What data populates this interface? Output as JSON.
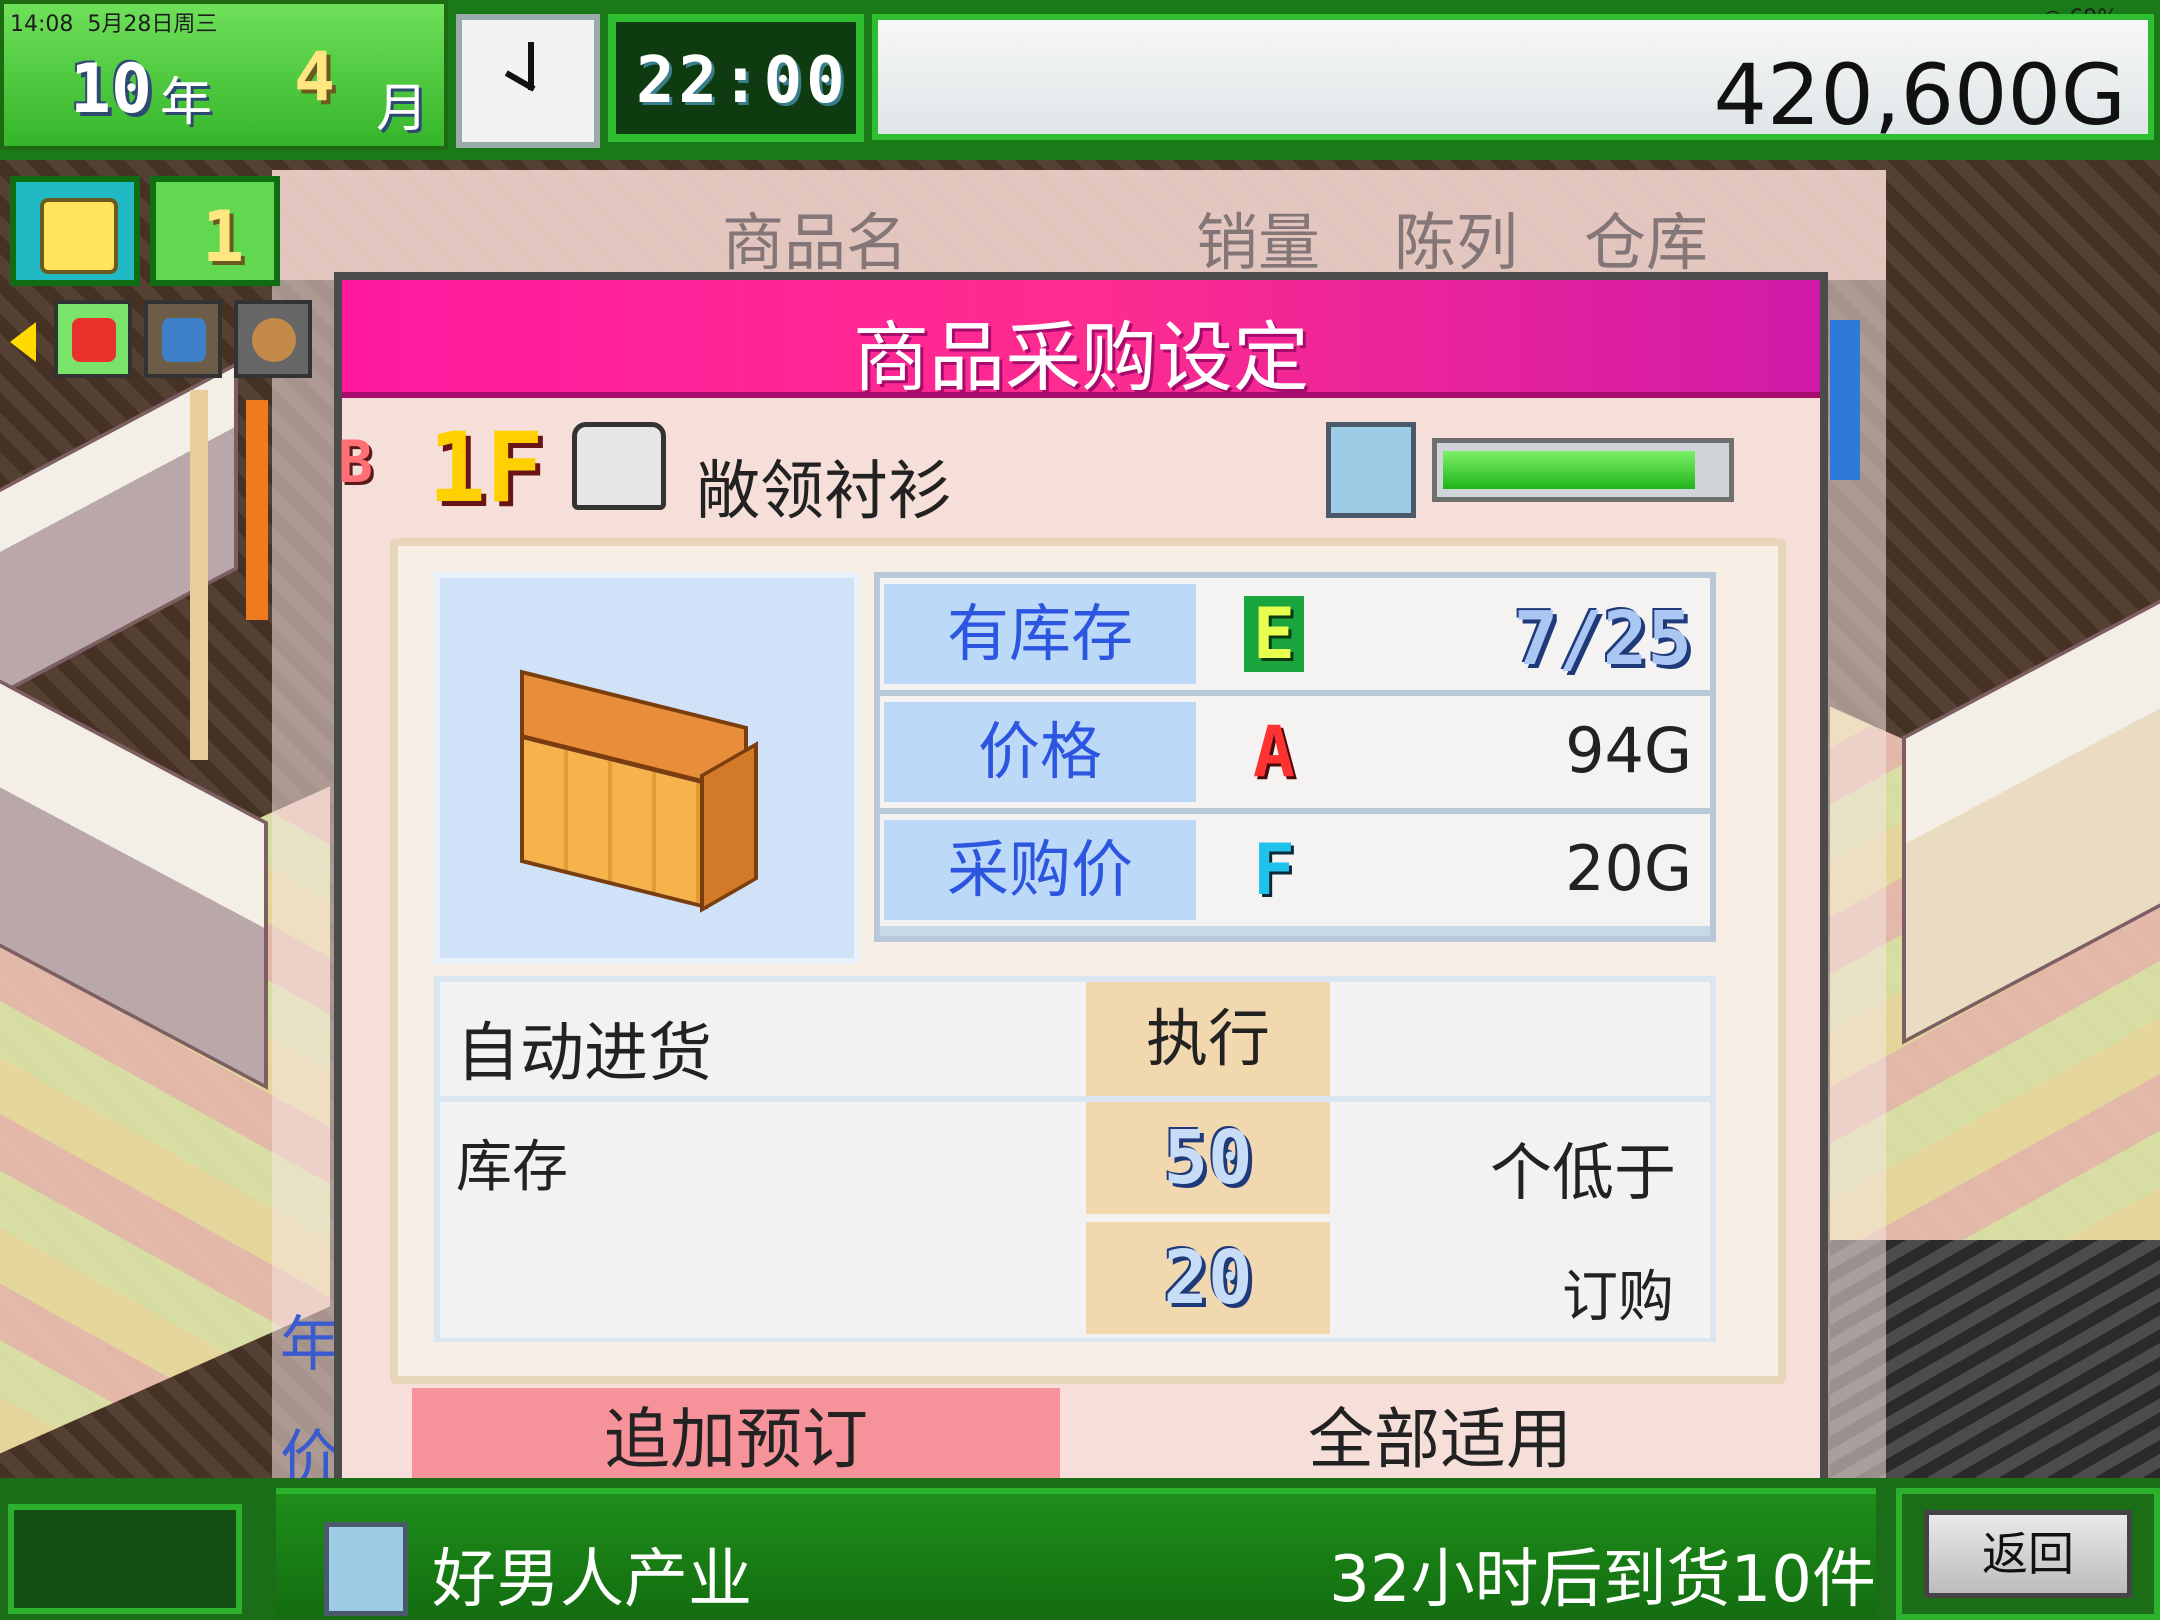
{
  "status_bar": {
    "time": "14:08",
    "date": "5月28日周三",
    "battery": "69%"
  },
  "header": {
    "year_value": "10",
    "year_unit": "年",
    "month_value": "4",
    "month_unit": "月",
    "game_time": "22:00",
    "money": "420,600G"
  },
  "side_panel": {
    "counter_partial": "1"
  },
  "list_header": {
    "name": "商品名",
    "sales": "销量",
    "display": "陈列",
    "warehouse": "仓库"
  },
  "side_labels": {
    "year_partial": "年",
    "price_partial": "价"
  },
  "dialog": {
    "title": "商品采购设定",
    "floor_badge": "B",
    "floor": "1F",
    "item_name": "敞领衬衫",
    "capacity_fraction": 0.9,
    "stats": [
      {
        "label": "有库存",
        "rank": "E",
        "value": "7/25"
      },
      {
        "label": "价格",
        "rank": "A",
        "value": "94G"
      },
      {
        "label": "采购价",
        "rank": "F",
        "value": "20G"
      }
    ],
    "auto_restock_label": "自动进货",
    "execute_label": "执行",
    "stock_label": "库存",
    "threshold_value": "50",
    "threshold_suffix": "个低于",
    "order_value": "20",
    "order_label": "订购",
    "add_order_label": "追加预订",
    "apply_all_label": "全部适用"
  },
  "footer": {
    "supplier": "好男人产业",
    "arrival": "32小时后到货10件",
    "back_label": "返回"
  },
  "colors": {
    "title_bar": "#ff1aa0",
    "accent_green": "#2fbe32",
    "label_blue": "#2c55e0"
  }
}
